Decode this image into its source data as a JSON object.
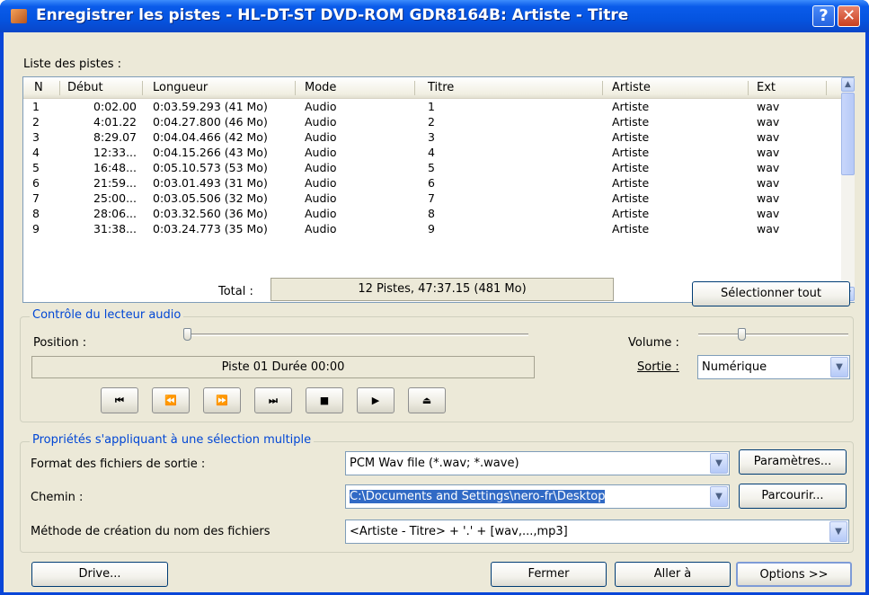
{
  "window": {
    "title": "Enregistrer les pistes - HL-DT-ST DVD-ROM GDR8164B:  Artiste - Titre",
    "help": "?",
    "close": "✕"
  },
  "tracklist": {
    "label": "Liste des pistes :",
    "columns": [
      "N",
      "Début",
      "Longueur",
      "Mode",
      "Titre",
      "Artiste",
      "Ext"
    ],
    "rows": [
      [
        "1",
        "0:02.00",
        "0:03.59.293 (41 Mo)",
        "Audio",
        "1",
        "Artiste",
        "wav"
      ],
      [
        "2",
        "4:01.22",
        "0:04.27.800 (46 Mo)",
        "Audio",
        "2",
        "Artiste",
        "wav"
      ],
      [
        "3",
        "8:29.07",
        "0:04.04.466 (42 Mo)",
        "Audio",
        "3",
        "Artiste",
        "wav"
      ],
      [
        "4",
        "12:33...",
        "0:04.15.266 (43 Mo)",
        "Audio",
        "4",
        "Artiste",
        "wav"
      ],
      [
        "5",
        "16:48...",
        "0:05.10.573 (53 Mo)",
        "Audio",
        "5",
        "Artiste",
        "wav"
      ],
      [
        "6",
        "21:59...",
        "0:03.01.493 (31 Mo)",
        "Audio",
        "6",
        "Artiste",
        "wav"
      ],
      [
        "7",
        "25:00...",
        "0:03.05.506 (32 Mo)",
        "Audio",
        "7",
        "Artiste",
        "wav"
      ],
      [
        "8",
        "28:06...",
        "0:03.32.560 (36 Mo)",
        "Audio",
        "8",
        "Artiste",
        "wav"
      ],
      [
        "9",
        "31:38...",
        "0:03.24.773 (35 Mo)",
        "Audio",
        "9",
        "Artiste",
        "wav"
      ]
    ],
    "total_label": "Total :",
    "total_value": "12 Pistes,   47:37.15 (481 Mo)",
    "select_all": "Sélectionner tout"
  },
  "player": {
    "group_label": "Contrôle du lecteur audio",
    "position_label": "Position :",
    "position": 0,
    "status": "Piste 01 Durée 00:00",
    "volume_label": "Volume :",
    "volume": 0.28,
    "output_label": "Sortie :",
    "output_value": "Numérique",
    "buttons": [
      {
        "name": "previous-track-button",
        "glyph": "⏮"
      },
      {
        "name": "rewind-button",
        "glyph": "⏪"
      },
      {
        "name": "fast-forward-button",
        "glyph": "⏩"
      },
      {
        "name": "next-track-button",
        "glyph": "⏭"
      },
      {
        "name": "stop-button",
        "glyph": "■"
      },
      {
        "name": "play-button",
        "glyph": "▶"
      },
      {
        "name": "eject-button",
        "glyph": "⏏"
      }
    ]
  },
  "properties": {
    "group_label": "Propriétés s'appliquant à une sélection multiple",
    "format_label": "Format des fichiers de sortie :",
    "format_value": "PCM Wav file (*.wav; *.wave)",
    "params_button": "Paramètres...",
    "path_label": "Chemin :",
    "path_value": "C:\\Documents and Settings\\nero-fr\\Desktop",
    "browse_button": "Parcourir...",
    "naming_label": "Méthode de création du nom des fichiers",
    "naming_value": "<Artiste - Titre> + '.' + [wav,...,mp3]"
  },
  "footer": {
    "drive": "Drive...",
    "close": "Fermer",
    "goto": "Aller à",
    "options": "Options >>"
  },
  "colors": {
    "accent": "#0046d5",
    "selection": "#316ac5",
    "titlebar": "#0554e0"
  }
}
